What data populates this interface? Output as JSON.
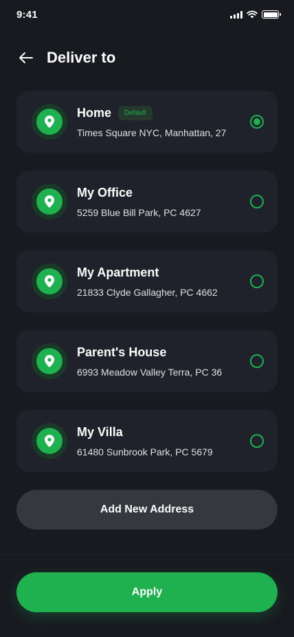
{
  "status_bar": {
    "time": "9:41"
  },
  "header": {
    "title": "Deliver to",
    "back_icon": "arrow-left-icon"
  },
  "addresses": [
    {
      "name": "Home",
      "badge": "Default",
      "detail": "Times Square NYC, Manhattan, 27",
      "selected": true
    },
    {
      "name": "My Office",
      "detail": "5259 Blue Bill Park, PC 4627",
      "selected": false
    },
    {
      "name": "My Apartment",
      "detail": "21833 Clyde Gallagher, PC 4662",
      "selected": false
    },
    {
      "name": "Parent's House",
      "detail": "6993 Meadow Valley Terra, PC 36",
      "selected": false
    },
    {
      "name": "My Villa",
      "detail": "61480 Sunbrook Park, PC 5679",
      "selected": false
    }
  ],
  "actions": {
    "add_label": "Add New Address",
    "apply_label": "Apply"
  },
  "colors": {
    "accent": "#1fb04f",
    "background": "#181a20",
    "card": "#1f222a",
    "button_secondary": "#35383f"
  }
}
